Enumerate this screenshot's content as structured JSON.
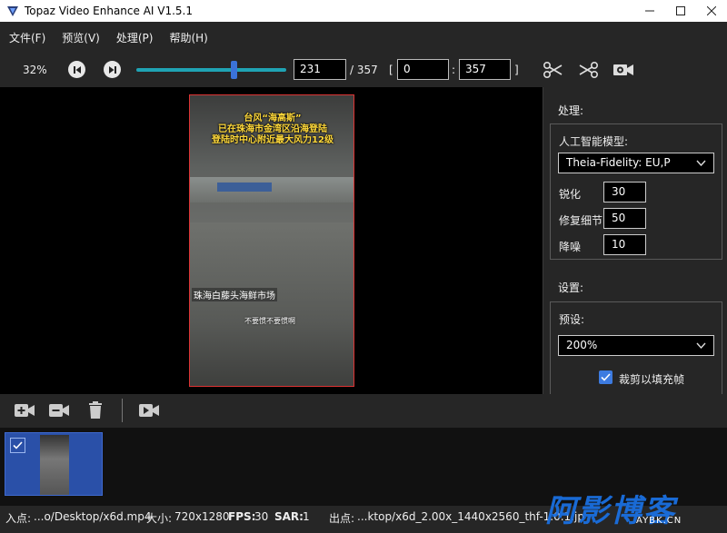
{
  "window": {
    "title": "Topaz Video Enhance AI V1.5.1"
  },
  "menu": [
    "文件(F)",
    "预览(V)",
    "处理(P)",
    "帮助(H)"
  ],
  "toolbar": {
    "zoom": "32%",
    "current_frame": "231",
    "total_frames": "/ 357",
    "range_open": "[",
    "range_start": "0",
    "range_sep": ":",
    "range_end": "357",
    "range_close": "]",
    "slider_fraction": 0.647
  },
  "video": {
    "overlay_title_1": "台风“海高斯”",
    "overlay_title_2": "已在珠海市金湾区沿海登陆",
    "overlay_title_3": "登陆时中心附近最大风力12级",
    "location_caption": "珠海白藤头海鲜市场",
    "subtitle": "不要惯不要惯啊"
  },
  "processing": {
    "section_title": "处理:",
    "model_label": "人工智能模型:",
    "model_value": "Theia-Fidelity: EU,P",
    "sharpen_label": "锐化",
    "sharpen_value": "30",
    "detail_label": "修复细节",
    "detail_value": "50",
    "denoise_label": "降噪",
    "denoise_value": "10"
  },
  "settings": {
    "section_title": "设置:",
    "preset_label": "预设:",
    "preset_value": "200%",
    "crop_label": "裁剪以填充帧",
    "crop_checked": true
  },
  "status": {
    "in_label": "入点:",
    "in_value": "...o/Desktop/x6d.mp4",
    "size_label": "大小:",
    "size_value": "720x1280",
    "fps_label": "FPS:",
    "fps_value": "30",
    "sar_label": "SAR:",
    "sar_value": "1",
    "out_label": "出点:",
    "out_value": "...ktop/x6d_2.00x_1440x2560_thf-1.0.1.jp"
  },
  "watermark": {
    "text": "阿影博客",
    "sub": "AYBK.CN"
  },
  "colors": {
    "accent": "#3d7be0",
    "slider": "#1fa3b4",
    "frame_border": "#dd3333"
  }
}
